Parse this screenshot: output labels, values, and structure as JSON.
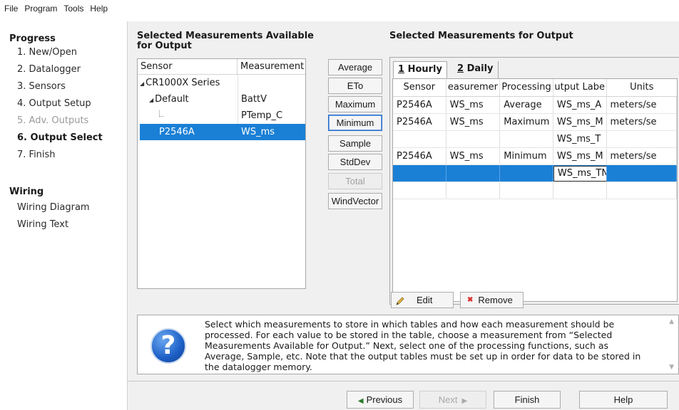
{
  "menu": [
    "File",
    "Program",
    "Tools",
    "Help"
  ],
  "progress": {
    "title": "Progress",
    "steps": [
      {
        "label": "1. New/Open",
        "state": "normal"
      },
      {
        "label": "2. Datalogger",
        "state": "normal"
      },
      {
        "label": "3. Sensors",
        "state": "normal"
      },
      {
        "label": "4. Output Setup",
        "state": "normal"
      },
      {
        "label": "5. Adv. Outputs",
        "state": "disabled"
      },
      {
        "label": "6. Output Select",
        "state": "active"
      },
      {
        "label": "7. Finish",
        "state": "normal"
      }
    ]
  },
  "wiring": {
    "title": "Wiring",
    "items": [
      "Wiring Diagram",
      "Wiring Text"
    ]
  },
  "available": {
    "title_line1": "Selected Measurements Available",
    "title_line2": "for Output",
    "col_sensor": "Sensor",
    "col_measurement": "Measurement",
    "rows": [
      {
        "sensor": "CR1000X Series",
        "measurement": ""
      },
      {
        "sensor": "Default",
        "measurement": "BattV"
      },
      {
        "sensor": "",
        "measurement": "PTemp_C"
      },
      {
        "sensor": "P2546A",
        "measurement": "WS_ms"
      }
    ]
  },
  "processing_buttons": [
    {
      "label": "Average",
      "enabled": true
    },
    {
      "label": "ETo",
      "enabled": true
    },
    {
      "label": "Maximum",
      "enabled": true
    },
    {
      "label": "Minimum",
      "enabled": true
    },
    {
      "label": "Sample",
      "enabled": true
    },
    {
      "label": "StdDev",
      "enabled": true
    },
    {
      "label": "Total",
      "enabled": false
    },
    {
      "label": "WindVector",
      "enabled": true
    }
  ],
  "output": {
    "title": "Selected Measurements for Output",
    "tabs": [
      {
        "num": "1",
        "name": "Hourly"
      },
      {
        "num": "2",
        "name": "Daily"
      }
    ],
    "columns": [
      "Sensor",
      "easuremer",
      "Processing",
      "utput Labe",
      "Units"
    ],
    "rows": [
      {
        "sensor": "P2546A",
        "measurement": "WS_ms",
        "processing": "Average",
        "label": "WS_ms_A",
        "units": "meters/se"
      },
      {
        "sensor": "P2546A",
        "measurement": "WS_ms",
        "processing": "Maximum",
        "label": "WS_ms_M",
        "units": "meters/se"
      },
      {
        "sensor": "",
        "measurement": "",
        "processing": "",
        "label": "WS_ms_T",
        "units": ""
      },
      {
        "sensor": "P2546A",
        "measurement": "WS_ms",
        "processing": "Minimum",
        "label": "WS_ms_M",
        "units": "meters/se"
      },
      {
        "sensor": "",
        "measurement": "",
        "processing": "",
        "label": "WS_ms_TN",
        "units": ""
      }
    ],
    "edit_label": "Edit",
    "remove_label": "Remove"
  },
  "help_text": "Select which measurements to store in which tables and how each measurement should be processed. For each value to be stored in the table, choose a measurement from “Selected Measurements Available for Output.” Next, select one of the processing functions, such as Average, Sample, etc. Note that the output tables must be set up in order for data to be stored in the datalogger memory.",
  "nav": {
    "previous": "Previous",
    "next": "Next",
    "finish": "Finish",
    "help": "Help"
  },
  "colors": {
    "selection": "#1a80d6",
    "panel_bg": "#f0f0f0"
  },
  "icons": {
    "help": "question-mark-circle-icon",
    "edit": "pencil-icon",
    "remove": "red-x-icon"
  }
}
